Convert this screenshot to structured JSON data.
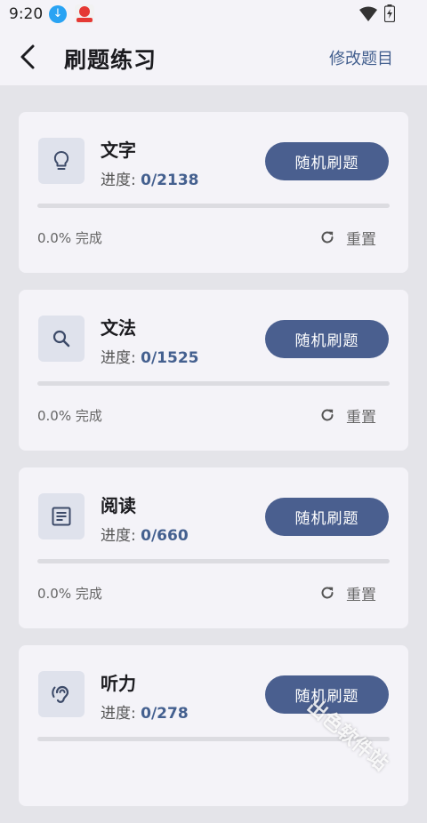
{
  "status_bar": {
    "time": "9:20"
  },
  "app_bar": {
    "title": "刷题练习",
    "action_label": "修改题目"
  },
  "colors": {
    "accent": "#4a5f8f",
    "card_bg": "#f4f3f8",
    "page_bg": "#e4e4e9"
  },
  "cards": [
    {
      "title": "文字",
      "progress_label": "进度: ",
      "progress_count": "0/2138",
      "button_label": "随机刷题",
      "percent_text": "0.0% 完成",
      "completion_fraction": 0,
      "reset_label": "重置",
      "icon": "lightbulb-icon"
    },
    {
      "title": "文法",
      "progress_label": "进度: ",
      "progress_count": "0/1525",
      "button_label": "随机刷题",
      "percent_text": "0.0% 完成",
      "completion_fraction": 0,
      "reset_label": "重置",
      "icon": "search-icon"
    },
    {
      "title": "阅读",
      "progress_label": "进度: ",
      "progress_count": "0/660",
      "button_label": "随机刷题",
      "percent_text": "0.0% 完成",
      "completion_fraction": 0,
      "reset_label": "重置",
      "icon": "article-icon"
    },
    {
      "title": "听力",
      "progress_label": "进度: ",
      "progress_count": "0/278",
      "button_label": "随机刷题",
      "percent_text": "",
      "completion_fraction": 0,
      "reset_label": "",
      "icon": "hearing-icon"
    }
  ],
  "watermark": "出色软件站"
}
